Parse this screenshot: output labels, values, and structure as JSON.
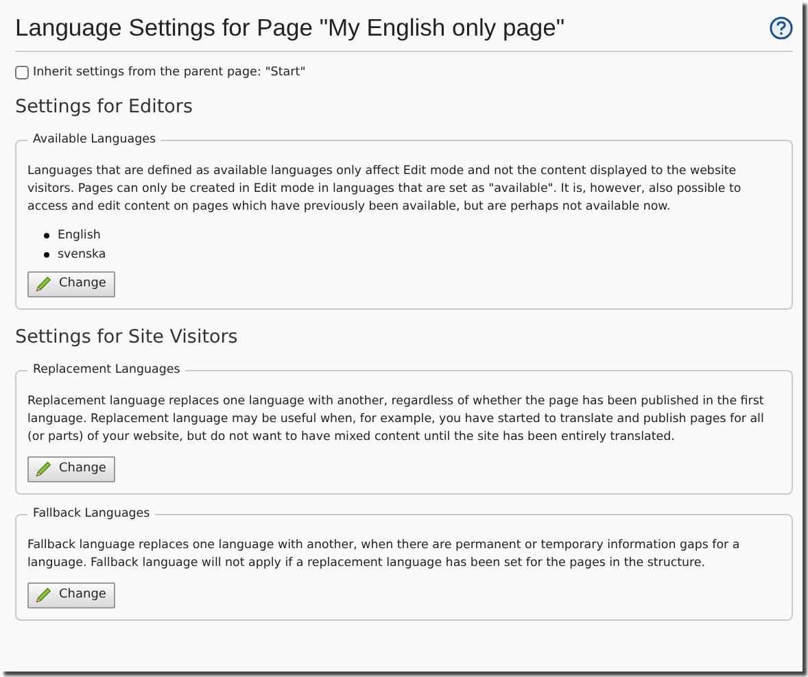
{
  "title": "Language Settings for Page \"My English only page\"",
  "inherit": {
    "label": "Inherit settings from the parent page: \"Start\"",
    "checked": false
  },
  "sections": [
    {
      "heading": "Settings for Editors",
      "groups": [
        {
          "legend": "Available Languages",
          "text": "Languages that are defined as available languages only affect Edit mode and not the content displayed to the website visitors. Pages can only be created in Edit mode in languages that are set as \"available\". It is, however, also possible to access and edit content on pages which have previously been available, but are perhaps not available now.",
          "items": [
            "English",
            "svenska"
          ],
          "button": "Change"
        }
      ]
    },
    {
      "heading": "Settings for Site Visitors",
      "groups": [
        {
          "legend": "Replacement Languages",
          "text": "Replacement language replaces one language with another, regardless of whether the page has been published in the first language. Replacement language may be useful when, for example, you have started to translate and publish pages for all (or parts) of your website, but do not want to have mixed content until the site has been entirely translated.",
          "button": "Change"
        },
        {
          "legend": "Fallback Languages",
          "text": "Fallback language replaces one language with another, when there are permanent or temporary information gaps for a language. Fallback language will not apply if a replacement language has been set for the pages in the structure.",
          "button": "Change"
        }
      ]
    }
  ]
}
